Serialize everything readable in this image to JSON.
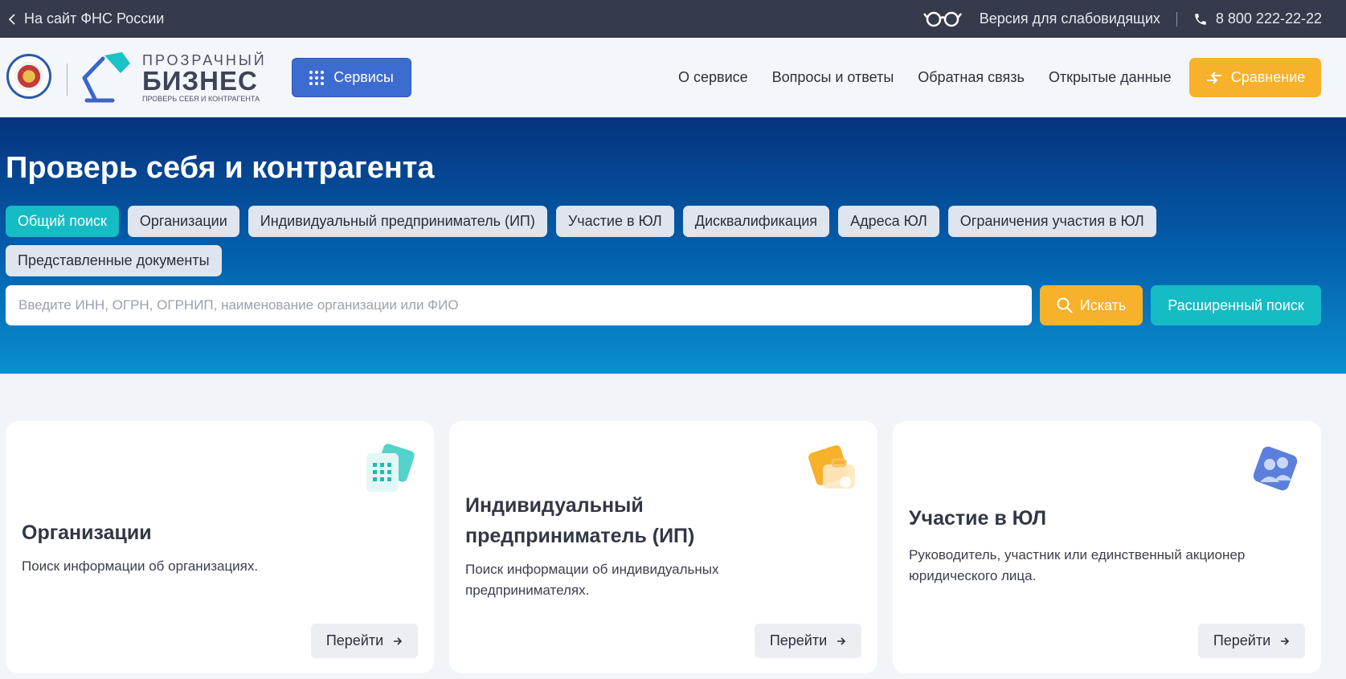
{
  "topbar": {
    "back_label": "На сайт ФНС России",
    "vision_label": "Версия для слабовидящих",
    "phone": "8 800 222-22-22"
  },
  "header": {
    "brand_line1": "ПРОЗРАЧНЫЙ",
    "brand_line2": "БИЗНЕС",
    "brand_line3": "ПРОВЕРЬ СЕБЯ И КОНТРАГЕНТА",
    "services_label": "Сервисы",
    "nav": [
      "О сервисе",
      "Вопросы и ответы",
      "Обратная связь",
      "Открытые данные"
    ],
    "compare_label": "Сравнение"
  },
  "hero": {
    "title": "Проверь себя и контрагента",
    "tabs": [
      "Общий поиск",
      "Организации",
      "Индивидуальный предприниматель (ИП)",
      "Участие в ЮЛ",
      "Дисквалификация",
      "Адреса ЮЛ",
      "Ограничения участия в ЮЛ",
      "Представленные документы"
    ],
    "active_tab": "Общий поиск",
    "search_value": "",
    "search_placeholder": "Введите ИНН, ОГРН, ОГРНИП, наименование организации или ФИО",
    "search_button": "Искать",
    "advanced_button": "Расширенный поиск"
  },
  "cards": [
    {
      "title": "Организации",
      "desc": "Поиск информации об организациях.",
      "button": "Перейти",
      "icon": "building-icon"
    },
    {
      "title": "Индивидуальный предприниматель (ИП)",
      "desc": "Поиск информации об индивидуальных предпринимателях.",
      "button": "Перейти",
      "icon": "briefcase-icon"
    },
    {
      "title": "Участие в ЮЛ",
      "desc": "Руководитель, участник или единственный акционер юридического лица.",
      "button": "Перейти",
      "icon": "people-icon"
    }
  ],
  "colors": {
    "topbar": "#353b4b",
    "primary_blue": "#3d6cd1",
    "accent_orange": "#f8b12b",
    "accent_teal": "#16bcc4",
    "hero_top": "#06337f",
    "hero_bottom": "#0a8fd0"
  }
}
